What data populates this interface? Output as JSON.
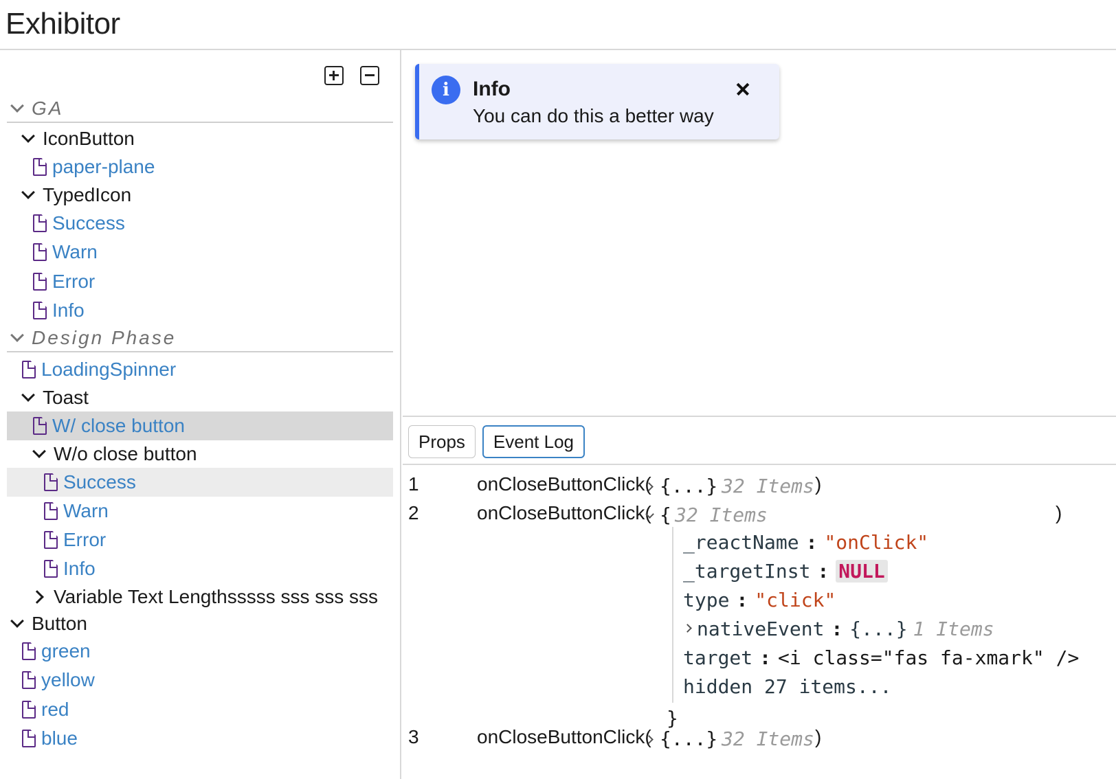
{
  "app": {
    "title": "Exhibitor"
  },
  "sidebar": {
    "tools": {
      "expand_all": "expand-all",
      "collapse_all": "collapse-all"
    },
    "sections": [
      {
        "label": "GA"
      },
      {
        "label": "Design Phase"
      }
    ],
    "items": {
      "iconbutton": "IconButton",
      "paper_plane": "paper-plane",
      "typedicon": "TypedIcon",
      "ti_success": "Success",
      "ti_warn": "Warn",
      "ti_error": "Error",
      "ti_info": "Info",
      "loading_spinner": "LoadingSpinner",
      "toast": "Toast",
      "with_close": "W/ close button",
      "without_close": "W/o close button",
      "wo_success": "Success",
      "wo_warn": "Warn",
      "wo_error": "Error",
      "wo_info": "Info",
      "variable_text": "Variable Text Lengthsssss sss sss sss",
      "button": "Button",
      "green": "green",
      "yellow": "yellow",
      "red": "red",
      "blue": "blue"
    }
  },
  "toast": {
    "title": "Info",
    "message": "You can do this a better way",
    "icon": "info-icon",
    "accent": "#3a6df0",
    "background": "#eef0fc"
  },
  "panel": {
    "tabs": [
      {
        "label": "Props"
      },
      {
        "label": "Event Log"
      }
    ],
    "active_tab": "Event Log",
    "log": [
      {
        "num": "1",
        "fn": "onCloseButtonClick(",
        "obj": "{...}",
        "hint": "32 Items",
        "close": ")"
      },
      {
        "num": "2",
        "fn": "onCloseButtonClick(",
        "obj": "{",
        "hint": "32 Items",
        "close": ")"
      },
      {
        "num": "3",
        "fn": "onCloseButtonClick(",
        "obj": "{...}",
        "hint": "32 Items",
        "close": ")"
      }
    ],
    "expanded": {
      "props": [
        {
          "key": "_reactName",
          "value": "\"onClick\""
        },
        {
          "key": "_targetInst",
          "value": "NULL"
        },
        {
          "key": "type",
          "value": "\"click\""
        },
        {
          "key": "nativeEvent",
          "value": "{...}",
          "hint": "1 Items"
        },
        {
          "key": "target",
          "value": "<i class=\"fas fa-xmark\" />"
        }
      ],
      "hidden": "hidden 27 items...",
      "closing": "}"
    }
  },
  "colors": {
    "link": "#3a82c4",
    "file_icon": "#5b2a86",
    "string": "#c0441a",
    "null": "#c2185b"
  }
}
